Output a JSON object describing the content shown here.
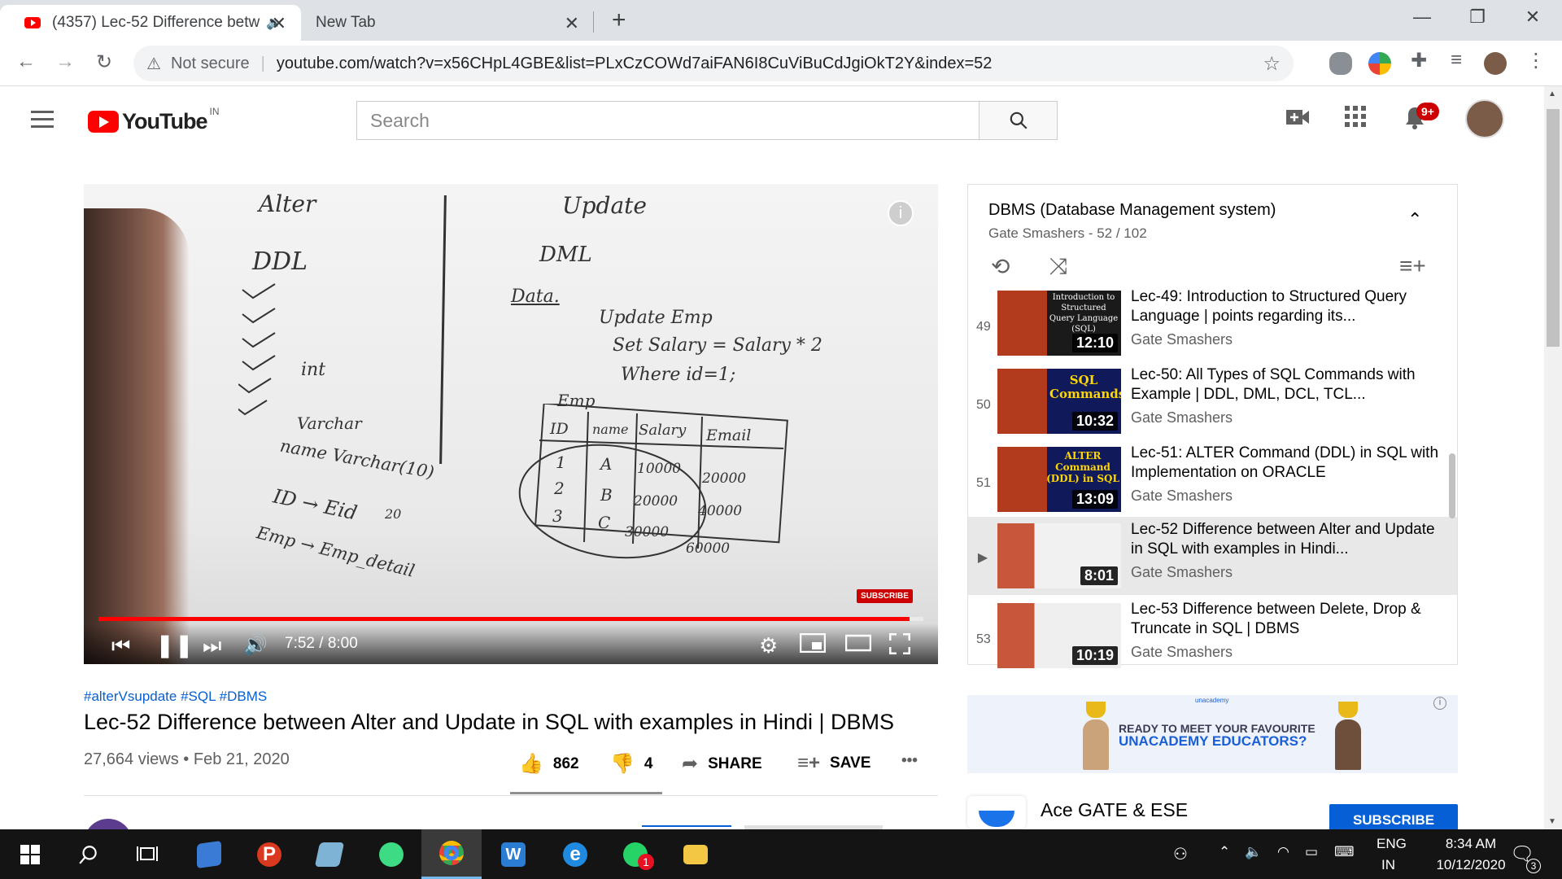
{
  "browser": {
    "tabs": [
      {
        "title": "(4357) Lec-52 Difference betw",
        "close": "✕"
      },
      {
        "title": "New Tab",
        "close": "✕"
      }
    ],
    "new_tab": "+",
    "window": {
      "minimize": "—",
      "restore": "❐",
      "close": "✕"
    },
    "nav": {
      "back": "←",
      "forward": "→",
      "reload": "↻"
    },
    "security_icon": "⚠",
    "security_label": "Not secure",
    "url_separator": "|",
    "url": "youtube.com/watch?v=x56CHpL4GBE&list=PLxCzCOWd7aiFAN6I8CuViBuCdJgiOkT2Y&index=52",
    "bookmark_icon": "☆"
  },
  "youtube": {
    "logo_text": "YouTube",
    "logo_country": "IN",
    "search_placeholder": "Search",
    "notification_count": "9+"
  },
  "player": {
    "time": "7:52 / 8:00",
    "progress": 0.983,
    "subscribe_badge": "SUBSCRIBE",
    "info": "i",
    "board": {
      "left_heading": "Alter",
      "left_type": "DDL",
      "right_heading": "Update",
      "right_type": "DML",
      "data_word": "Data.",
      "int_word": "int",
      "varchar_word": "Varchar",
      "name_line": "name Varchar(10)",
      "twenty": "20",
      "id_line": "ID → Eid",
      "emp_line": "Emp → Emp_detail",
      "sql1": "Update Emp",
      "sql2": "Set Salary = Salary * 2",
      "sql3": "Where id=1;",
      "table_name": "Emp",
      "table_headers": [
        "ID",
        "name",
        "Salary",
        "Email"
      ],
      "table_rows": [
        [
          "1",
          "A",
          "10000",
          "20000"
        ],
        [
          "2",
          "B",
          "20000",
          "40000"
        ],
        [
          "3",
          "C",
          "30000",
          "60000"
        ]
      ]
    }
  },
  "video": {
    "hashtags": "#alterVsupdate #SQL #DBMS",
    "title": "Lec-52 Difference between Alter and Update in SQL with examples in Hindi | DBMS",
    "meta": "27,664 views • Feb 21, 2020",
    "likes": "862",
    "dislikes": "4",
    "share": "SHARE",
    "save": "SAVE",
    "more": "•••"
  },
  "playlist": {
    "title": "DBMS (Database Management system)",
    "subtitle": "Gate Smashers - 52 / 102",
    "items": [
      {
        "index": "49",
        "title": "Lec-49: Introduction to Structured Query Language | points regarding its...",
        "channel": "Gate Smashers",
        "duration": "12:10",
        "thumb_text": "Introduction to Structured Query Language (SQL)"
      },
      {
        "index": "50",
        "title": "Lec-50: All Types of SQL Commands with Example | DDL, DML, DCL, TCL...",
        "channel": "Gate Smashers",
        "duration": "10:32",
        "thumb_text": "SQL Commands"
      },
      {
        "index": "51",
        "title": "Lec-51: ALTER Command (DDL) in SQL with Implementation on ORACLE",
        "channel": "Gate Smashers",
        "duration": "13:09",
        "thumb_text": "ALTER Command (DDL) in SQL"
      },
      {
        "index": "▶",
        "title": "Lec-52 Difference between Alter and Update in SQL with examples in Hindi...",
        "channel": "Gate Smashers",
        "duration": "8:01",
        "thumb_text": ""
      },
      {
        "index": "53",
        "title": "Lec-53 Difference between Delete, Drop & Truncate in SQL | DBMS",
        "channel": "Gate Smashers",
        "duration": "10:19",
        "thumb_text": ""
      }
    ]
  },
  "ad": {
    "brand": "unacademy",
    "line1": "READY TO MEET YOUR FAVOURITE",
    "line2": "UNACADEMY EDUCATORS?",
    "info": "i"
  },
  "next_channel": {
    "title": "Ace GATE & ESE",
    "subscribe": "SUBSCRIBE"
  },
  "taskbar": {
    "lang_top": "ENG",
    "lang_bottom": "IN",
    "time": "8:34 AM",
    "date": "10/12/2020",
    "notifications": "3",
    "whatsapp_badge": "1"
  }
}
